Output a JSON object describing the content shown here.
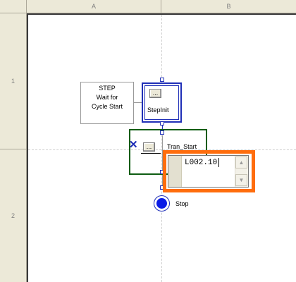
{
  "grid": {
    "columns": [
      "A",
      "B"
    ],
    "rows": [
      "1",
      "2"
    ]
  },
  "comment": {
    "line1": "STEP",
    "line2": "Wait for",
    "line3": "Cycle Start"
  },
  "step": {
    "name": "StepInit",
    "browse_label": "..."
  },
  "transition": {
    "name": "Tran_Start",
    "browse_label": "..."
  },
  "editor": {
    "value": "L002.10"
  },
  "stop": {
    "label": "Stop"
  },
  "colors": {
    "step_border": "#1f2fb7",
    "transition_border": "#0e5c12",
    "highlight": "#ff6d0d",
    "stop_fill": "#0a1ce6"
  }
}
